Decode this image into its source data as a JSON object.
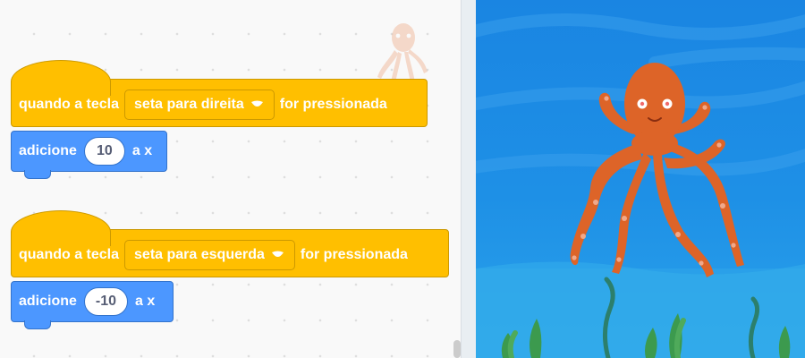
{
  "scripts": [
    {
      "hat": {
        "prefix": "quando a tecla",
        "key": "seta para direita",
        "suffix": "for pressionada"
      },
      "motion": {
        "label": "adicione",
        "value": "10",
        "suffix": "a x"
      }
    },
    {
      "hat": {
        "prefix": "quando a tecla",
        "key": "seta para esquerda",
        "suffix": "for pressionada"
      },
      "motion": {
        "label": "adicione",
        "value": "-10",
        "suffix": "a x"
      }
    }
  ],
  "icons": {
    "dropdown_caret": "chevron-down-icon",
    "sprite": "octopus-sprite"
  },
  "colors": {
    "events_block": "#ffbf00",
    "motion_block": "#4c97ff",
    "stage_water": "#1e8fe6",
    "octopus": "#e0672d"
  }
}
